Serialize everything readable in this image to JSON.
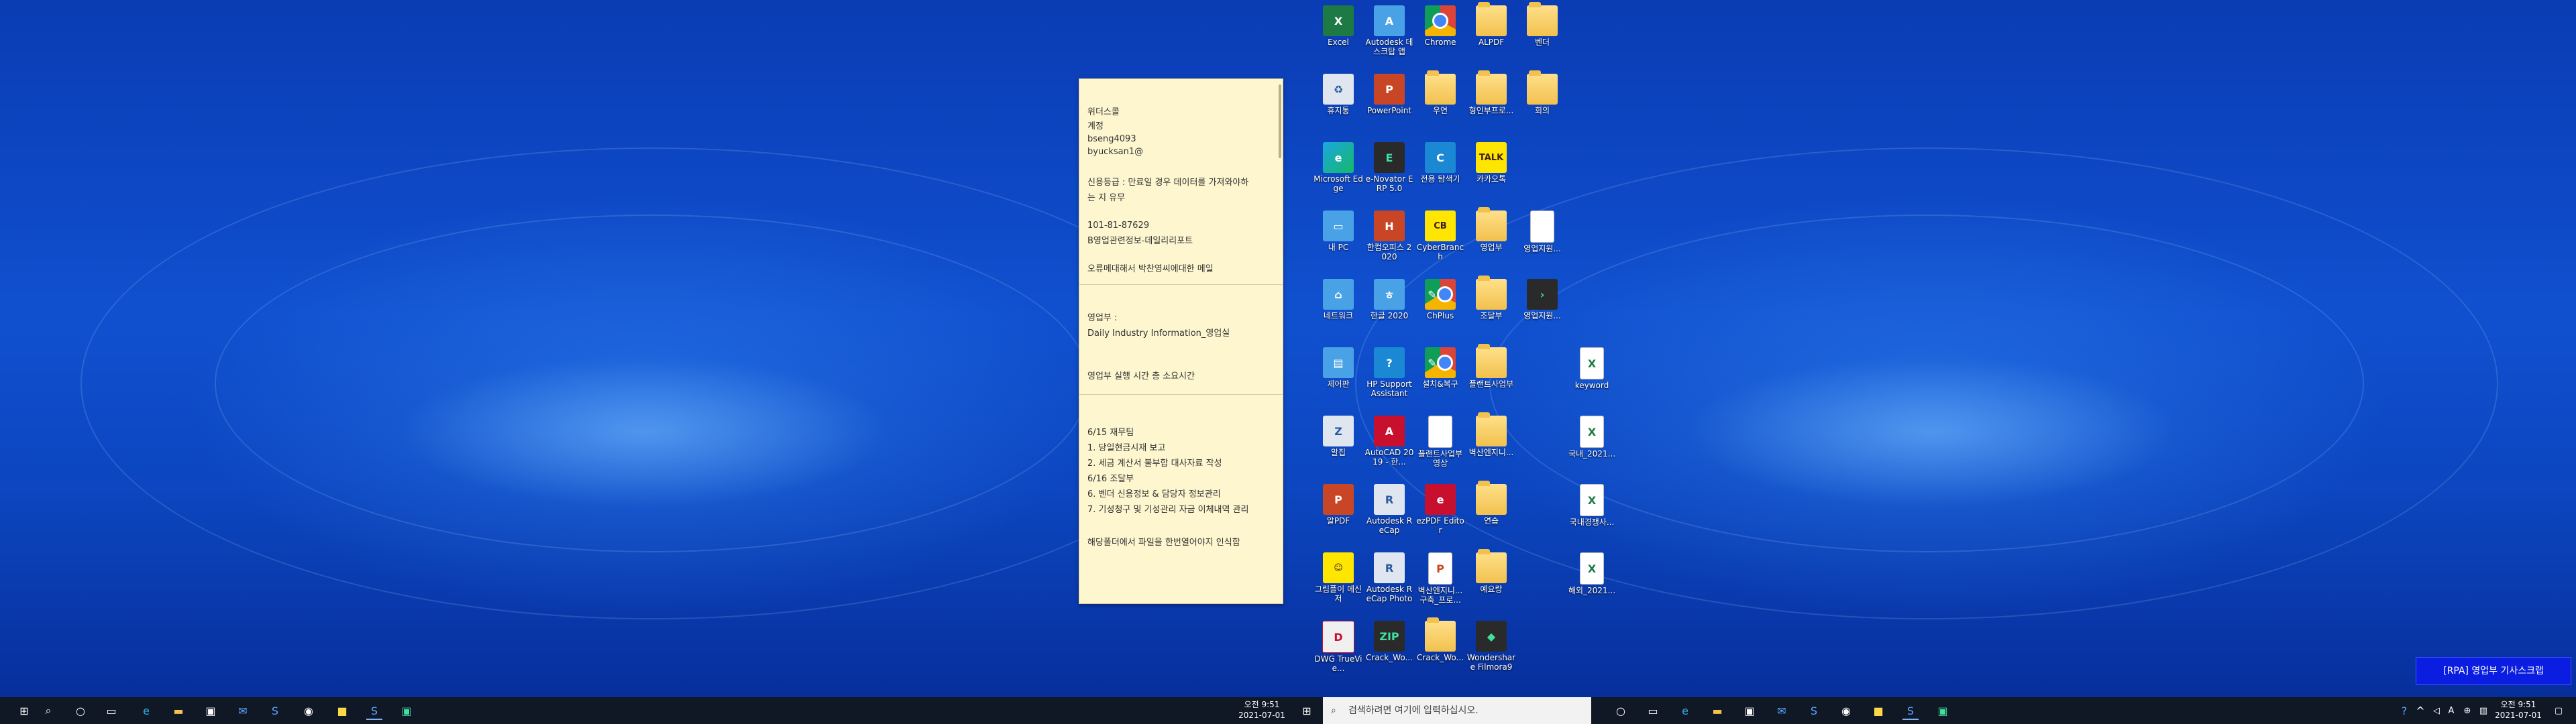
{
  "sticky_note": {
    "sections": [
      {
        "lines": [
          "위더스콜",
          "계정",
          "bseng4093",
          "byucksan1@"
        ]
      },
      {
        "lines": [
          "신용등급 : 만료일 경우 데이터를 가져와야하",
          "는 지 유무"
        ]
      },
      {
        "lines": [
          "101-81-87629",
          "B영업관련정보-데일리리포트"
        ]
      },
      {
        "lines": [
          "오류메대해서 박찬영씨에대한 메일"
        ]
      },
      {
        "lines": [
          "영업부 :",
          "Daily Industry Information_영업실"
        ]
      },
      {
        "lines": [
          "영업부 실행 시간 총 소요시간"
        ]
      },
      {
        "lines": [
          "6/15 재무팀",
          "1. 당일현금시재 보고",
          "2. 세금 계산서 불부합 대사자료 작성",
          "6/16 조달부",
          "6. 벤더 신용정보 & 담당자 정보관리",
          "7. 기성청구 및 기성관리 자금 이체내역 관리"
        ]
      },
      {
        "lines": [
          "해당폴더에서 파일을 한번열어야지 인식함"
        ]
      }
    ]
  },
  "desktop_icons": [
    {
      "label": "Excel",
      "icon": "excel-icon",
      "glyph": "X"
    },
    {
      "label": "Autodesk 데스크탑 앱",
      "icon": "autodesk-icon",
      "glyph": "A"
    },
    {
      "label": "Chrome",
      "icon": "chrome-icon",
      "glyph": ""
    },
    {
      "label": "ALPDF",
      "icon": "folder-icon",
      "glyph": ""
    },
    {
      "label": "벤더",
      "icon": "folder-icon",
      "glyph": ""
    },
    {
      "label": "휴지통",
      "icon": "recycle-bin-icon",
      "glyph": "♻"
    },
    {
      "label": "PowerPoint",
      "icon": "powerpoint-icon",
      "glyph": "P"
    },
    {
      "label": "우연",
      "icon": "folder-icon",
      "glyph": ""
    },
    {
      "label": "형인부프로...",
      "icon": "folder-icon",
      "glyph": ""
    },
    {
      "label": "회의",
      "icon": "folder-icon",
      "glyph": ""
    },
    {
      "label": "Microsoft Edge",
      "icon": "edge-icon",
      "glyph": "e"
    },
    {
      "label": "e-Novator ERP 5.0",
      "icon": "erp-icon",
      "glyph": "E"
    },
    {
      "label": "전용 탐색기",
      "icon": "explorer-icon",
      "glyph": "C"
    },
    {
      "label": "카카오톡",
      "icon": "kakaotalk-icon",
      "glyph": "TALK"
    },
    {
      "label": "내 PC",
      "icon": "pc-icon",
      "glyph": "▭"
    },
    {
      "label": "한컴오피스 2020",
      "icon": "hancom-icon",
      "glyph": "H"
    },
    {
      "label": "CyberBranch",
      "icon": "cyberbranch-icon",
      "glyph": "CB"
    },
    {
      "label": "영업부",
      "icon": "folder-icon",
      "glyph": ""
    },
    {
      "label": "영업지원...",
      "icon": "document-icon",
      "glyph": ""
    },
    {
      "label": "네트워크",
      "icon": "network-icon",
      "glyph": "⌂"
    },
    {
      "label": "한글 2020",
      "icon": "hangul-icon",
      "glyph": "ㅎ"
    },
    {
      "label": "ChPlus",
      "icon": "chplus-icon",
      "glyph": "✎"
    },
    {
      "label": "조달부",
      "icon": "folder-icon",
      "glyph": ""
    },
    {
      "label": "영업지원...",
      "icon": "shortcut-icon",
      "glyph": "›"
    },
    {
      "label": "제어판",
      "icon": "control-panel-icon",
      "glyph": "▤"
    },
    {
      "label": "HP Support Assistant",
      "icon": "help-icon",
      "glyph": "?"
    },
    {
      "label": "설치&복구",
      "icon": "install-icon",
      "glyph": "✎"
    },
    {
      "label": "플랜트사업부",
      "icon": "folder-icon",
      "glyph": ""
    },
    {
      "label": "keyword",
      "icon": "excel-file-icon",
      "glyph": "X"
    },
    {
      "label": "알집",
      "icon": "alzip-icon",
      "glyph": "Z"
    },
    {
      "label": "AutoCAD 2019 - 한...",
      "icon": "autocad-icon",
      "glyph": "A"
    },
    {
      "label": "플랜트사업부 영상",
      "icon": "document-icon",
      "glyph": ""
    },
    {
      "label": "벽산엔지니...",
      "icon": "folder-icon",
      "glyph": ""
    },
    {
      "label": "국내_2021...",
      "icon": "excel-file-icon",
      "glyph": "X"
    },
    {
      "label": "알PDF",
      "icon": "alpdf-icon",
      "glyph": "P"
    },
    {
      "label": "Autodesk ReCap",
      "icon": "recap-icon",
      "glyph": "R"
    },
    {
      "label": "ezPDF Editor",
      "icon": "ezpdf-icon",
      "glyph": "e"
    },
    {
      "label": "연습",
      "icon": "folder-icon",
      "glyph": ""
    },
    {
      "label": "국내경쟁사...",
      "icon": "excel-file-icon",
      "glyph": "X"
    },
    {
      "label": "그림플이 메신저",
      "icon": "messenger-icon",
      "glyph": "☺"
    },
    {
      "label": "Autodesk ReCap Photo",
      "icon": "recap-icon",
      "glyph": "R"
    },
    {
      "label": "벽산엔지니... 구축_프로...",
      "icon": "powerpoint-file-icon",
      "glyph": "P"
    },
    {
      "label": "예요랑",
      "icon": "folder-icon",
      "glyph": ""
    },
    {
      "label": "해외_2021...",
      "icon": "excel-file-icon",
      "glyph": "X"
    },
    {
      "label": "DWG TrueVie...",
      "icon": "dwg-icon",
      "glyph": "D"
    },
    {
      "label": "Crack_Wo...",
      "icon": "zip-icon",
      "glyph": "ZIP"
    },
    {
      "label": "Crack_Wo...",
      "icon": "folder-icon",
      "glyph": ""
    },
    {
      "label": "Wondershare Filmora9",
      "icon": "filmora-icon",
      "glyph": "◆"
    }
  ],
  "taskbar_left": {
    "icons": [
      "windows-icon",
      "search-icon",
      "cortana-icon",
      "task-view-icon",
      "edge-icon",
      "file-explorer-icon",
      "store-icon",
      "mail-icon",
      "app-icon",
      "chrome-icon",
      "sticky-notes-icon",
      "app-icon",
      "app-icon"
    ],
    "time": "오전 9:51",
    "date": "2021-07-01"
  },
  "taskbar_right": {
    "search_placeholder": "검색하려면 여기에 입력하십시오.",
    "icons": [
      "cortana-icon",
      "task-view-icon",
      "edge-icon",
      "file-explorer-icon",
      "store-icon",
      "mail-icon",
      "app-icon",
      "chrome-icon",
      "sticky-notes-icon",
      "app-icon",
      "app-icon"
    ],
    "tray_text": "A",
    "time": "오전 9:51",
    "date": "2021-07-01"
  },
  "rpa_notification": "[RPA] 영업부 기사스크랩"
}
